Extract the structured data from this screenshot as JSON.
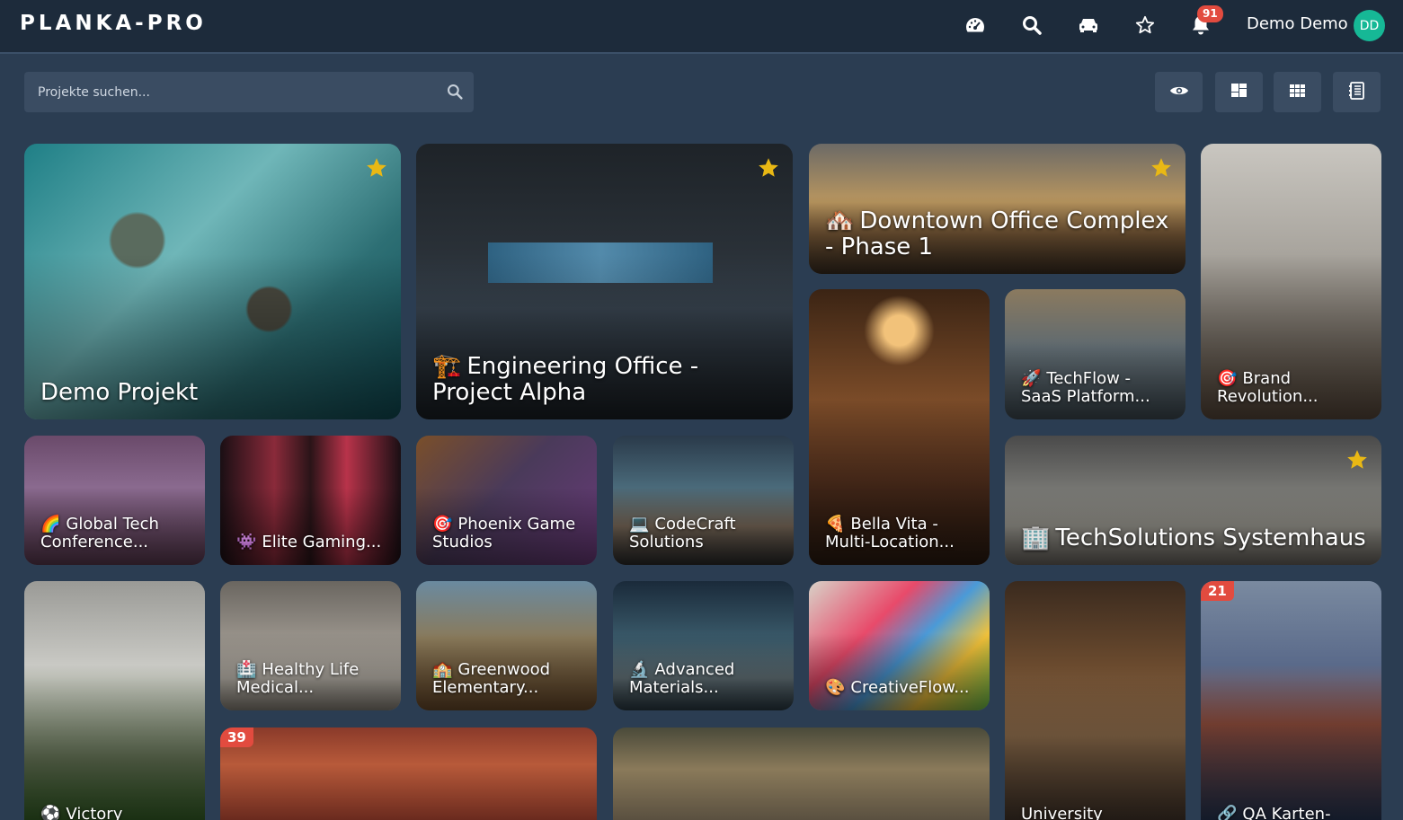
{
  "app": {
    "brand": "PLANKA-PRO"
  },
  "header": {
    "notification_count": "91",
    "user_name": "Demo Demo",
    "user_initials": "DD",
    "icons": [
      "dashboard-icon",
      "search-icon",
      "projects-icon",
      "favorites-icon",
      "bell-icon"
    ]
  },
  "toolbar": {
    "search_placeholder": "Projekte suchen...",
    "view_buttons": [
      "eye-icon",
      "masonry-view-icon",
      "grid-view-icon",
      "list-view-icon"
    ]
  },
  "colors": {
    "topbar": "#1d2b3b",
    "background": "#2b3d52",
    "accent": "#16b896",
    "badge": "#e24b3f",
    "star": "#e9b814"
  },
  "projects": [
    {
      "title": "Demo Projekt",
      "emoji": "",
      "favorite": true,
      "count": ""
    },
    {
      "title": "Engineering Office - Project Alpha",
      "emoji": "🏗️",
      "favorite": true,
      "count": ""
    },
    {
      "title": "Downtown Office Complex - Phase 1",
      "emoji": "🏘️",
      "favorite": true,
      "count": ""
    },
    {
      "title": "Bella Vita - Multi-Location...",
      "emoji": "🍕",
      "favorite": false,
      "count": ""
    },
    {
      "title": "TechFlow - SaaS Platform...",
      "emoji": "🚀",
      "favorite": false,
      "count": ""
    },
    {
      "title": "Brand Revolution...",
      "emoji": "🎯",
      "favorite": false,
      "count": ""
    },
    {
      "title": "Global Tech Conference...",
      "emoji": "🌈",
      "favorite": false,
      "count": ""
    },
    {
      "title": "Elite Gaming...",
      "emoji": "👾",
      "favorite": false,
      "count": ""
    },
    {
      "title": "Phoenix Game Studios",
      "emoji": "🎯",
      "favorite": false,
      "count": ""
    },
    {
      "title": "CodeCraft Solutions",
      "emoji": "💻",
      "favorite": false,
      "count": ""
    },
    {
      "title": "TechSolutions Systemhaus",
      "emoji": "🏢",
      "favorite": true,
      "count": ""
    },
    {
      "title": "Victory",
      "emoji": "⚽",
      "favorite": false,
      "count": ""
    },
    {
      "title": "Healthy Life Medical...",
      "emoji": "🏥",
      "favorite": false,
      "count": ""
    },
    {
      "title": "Greenwood Elementary...",
      "emoji": "🏫",
      "favorite": false,
      "count": ""
    },
    {
      "title": "Advanced Materials...",
      "emoji": "🔬",
      "favorite": false,
      "count": ""
    },
    {
      "title": "CreativeFlow...",
      "emoji": "🎨",
      "favorite": false,
      "count": ""
    },
    {
      "title": "University",
      "emoji": "",
      "favorite": false,
      "count": ""
    },
    {
      "title": "QA Karten-",
      "emoji": "🔗",
      "favorite": false,
      "count": "21"
    },
    {
      "title": "",
      "emoji": "",
      "favorite": false,
      "count": "39"
    },
    {
      "title": "",
      "emoji": "",
      "favorite": false,
      "count": ""
    }
  ]
}
